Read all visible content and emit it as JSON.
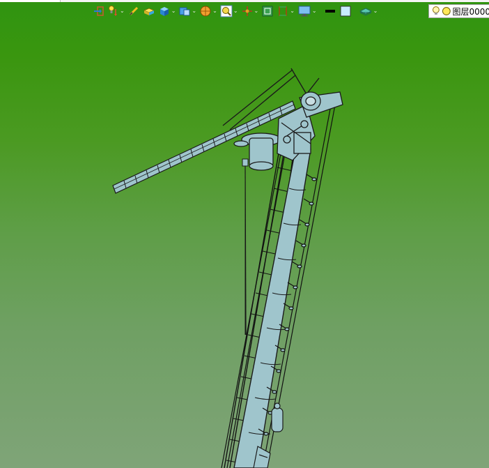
{
  "toolbar": {
    "buttons": [
      {
        "icon": "import-icon",
        "dropdown": false
      },
      {
        "icon": "light-bulb-icon",
        "dropdown": true
      },
      {
        "icon": "pen-icon",
        "dropdown": false
      },
      {
        "icon": "box-yellow-icon",
        "dropdown": false
      },
      {
        "icon": "cube-icon",
        "dropdown": true
      },
      {
        "icon": "view-cube-icon",
        "dropdown": true
      },
      {
        "icon": "render-ball-icon",
        "dropdown": true
      },
      {
        "icon": "zoom-icon",
        "dropdown": true
      },
      {
        "icon": "axis-icon",
        "dropdown": true
      },
      {
        "icon": "frame-icon",
        "dropdown": false
      },
      {
        "icon": "section-icon",
        "dropdown": true
      },
      {
        "icon": "monitor-icon",
        "dropdown": true
      },
      {
        "icon": "line-color-icon",
        "dropdown": false
      },
      {
        "icon": "fill-color-icon",
        "dropdown": false
      },
      {
        "icon": "layer-stack-icon",
        "dropdown": true
      }
    ]
  },
  "layer": {
    "name": "图层0000"
  },
  "colors": {
    "background_top": "#2f9410",
    "background_bottom": "#7fa478",
    "model_fill": "#9fc5cc",
    "model_stroke": "#1a1a1a"
  }
}
